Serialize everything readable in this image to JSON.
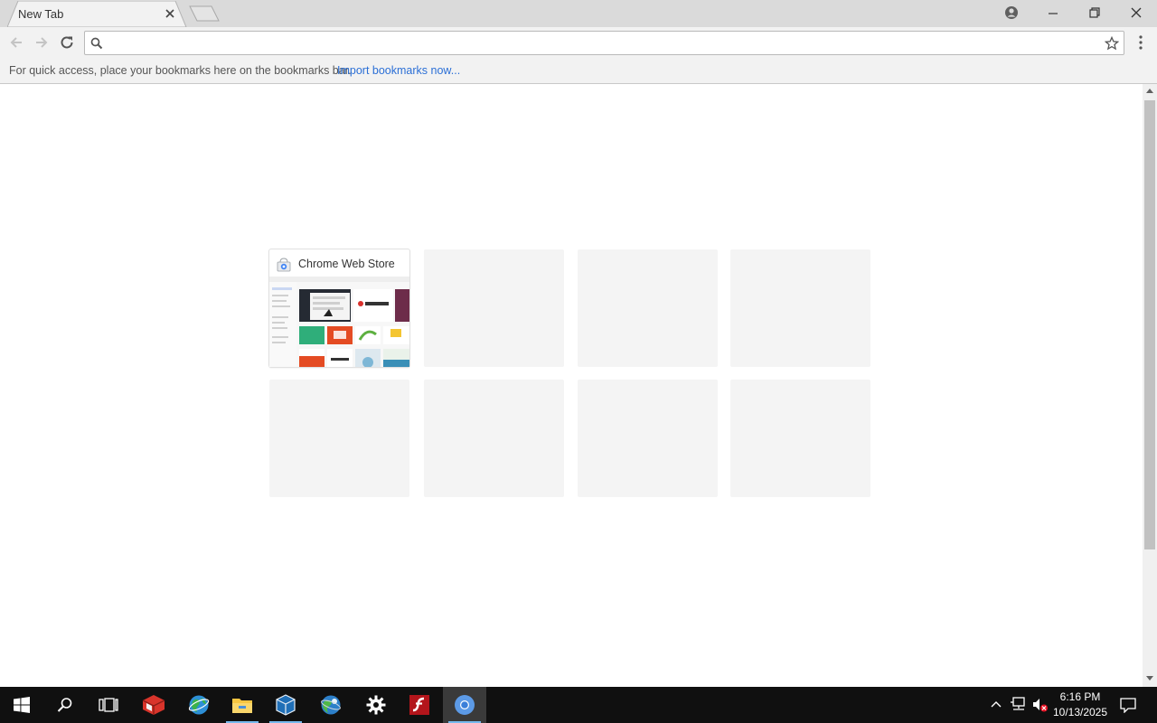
{
  "browser": {
    "tab_title": "New Tab",
    "omnibox": {
      "value": "",
      "placeholder": ""
    },
    "bookmarks_bar": {
      "hint": "For quick access, place your bookmarks here on the bookmarks bar.",
      "import_link": "Import bookmarks now..."
    }
  },
  "most_visited": [
    {
      "title": "Chrome Web Store",
      "filled": true
    },
    {
      "title": "",
      "filled": false
    },
    {
      "title": "",
      "filled": false
    },
    {
      "title": "",
      "filled": false
    },
    {
      "title": "",
      "filled": false
    },
    {
      "title": "",
      "filled": false
    },
    {
      "title": "",
      "filled": false
    },
    {
      "title": "",
      "filled": false
    }
  ],
  "taskbar": {
    "apps": [
      "windows-start",
      "search",
      "task-view",
      "app-red-cube",
      "app-globe",
      "file-explorer",
      "virtualbox",
      "app-globe-2",
      "settings",
      "flash",
      "chrome"
    ],
    "active_app": "chrome",
    "clock": {
      "time": "6:16 PM",
      "date": "10/13/2025"
    }
  },
  "colors": {
    "accent_link": "#2b6fd6",
    "taskbar": "#101010",
    "active_underline": "#76b9ed"
  }
}
